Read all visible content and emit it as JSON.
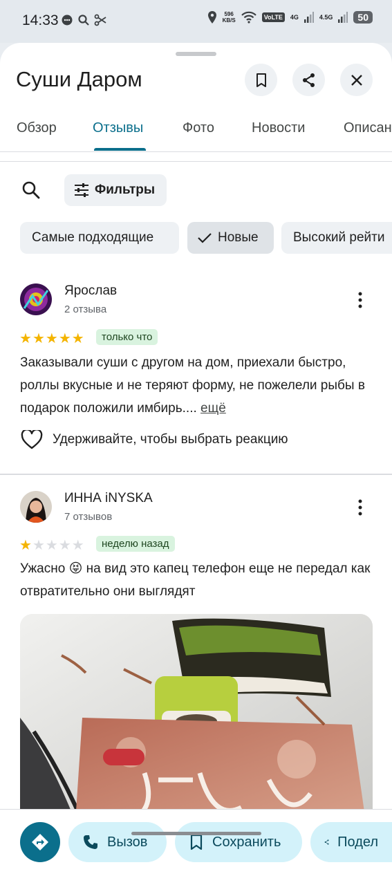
{
  "status_bar": {
    "time": "14:33",
    "speed_value": "596",
    "speed_unit": "KB/S",
    "volte": "VoLTE",
    "sim1": "4G",
    "sim2": "4.5G",
    "battery": "50"
  },
  "place": {
    "title": "Суши Даром"
  },
  "tabs": [
    {
      "label": "Обзор"
    },
    {
      "label": "Отзывы"
    },
    {
      "label": "Фото"
    },
    {
      "label": "Новости"
    },
    {
      "label": "Описан"
    }
  ],
  "toolbar": {
    "filters_label": "Фильтры"
  },
  "sort_options": [
    {
      "label": "Самые подходящие"
    },
    {
      "label": "Новые"
    },
    {
      "label": "Высокий рейти"
    }
  ],
  "reviews": [
    {
      "author": "Ярослав",
      "review_count": "2 отзыва",
      "rating": 5,
      "time": "только что",
      "text": "Заказывали суши с другом на дом, приехали быстро, роллы вкусные и не теряют форму, не пожелели рыбы в подарок положили имбирь....",
      "more": "ещё",
      "reaction_prompt": "Удерживайте, чтобы выбрать реакцию"
    },
    {
      "author": "ИННА iNYSKA",
      "review_count": "7 отзывов",
      "rating": 1,
      "time": "неделю назад",
      "text_before_emoji": "Ужасно",
      "emoji": "😝",
      "text_after_emoji": "на вид это капец телефон еще не передал как отвратительно они выглядят"
    }
  ],
  "actions": {
    "call": "Вызов",
    "save": "Сохранить",
    "share": "Подел"
  },
  "colors": {
    "accent": "#0b6f8c",
    "chip_bg": "#eef1f4",
    "action_chip_bg": "#d3f2fa",
    "star": "#f4b400",
    "badge_bg": "#d9f3df"
  }
}
